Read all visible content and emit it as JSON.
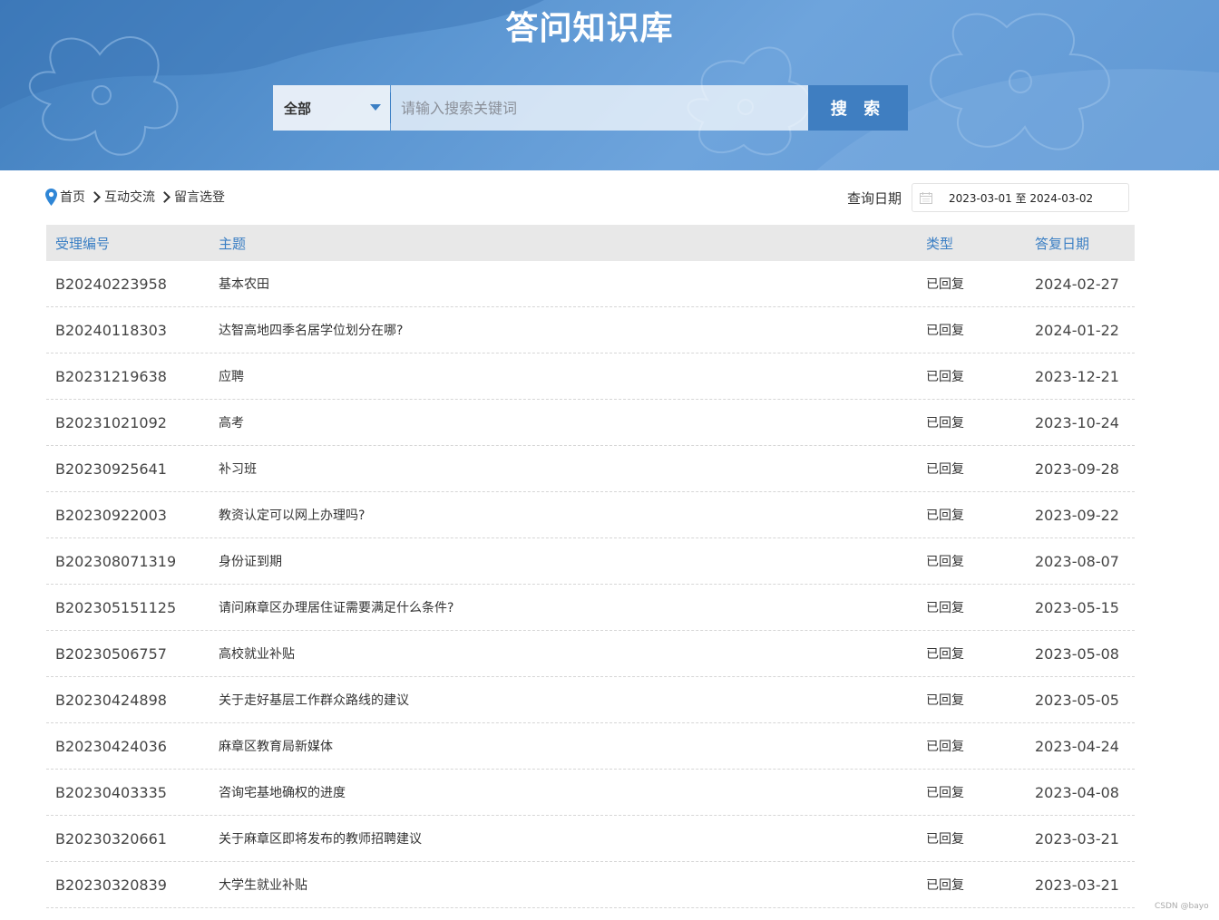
{
  "banner": {
    "title": "答问知识库"
  },
  "search": {
    "scope_value": "全部",
    "placeholder": "请输入搜索关键词",
    "button_label": "搜 索"
  },
  "breadcrumb": {
    "items": [
      "首页",
      "互动交流",
      "留言选登"
    ]
  },
  "date_query": {
    "label": "查询日期",
    "range": "2023-03-01 至 2024-03-02"
  },
  "table": {
    "headers": [
      "受理编号",
      "主题",
      "类型",
      "答复日期"
    ],
    "rows": [
      {
        "id": "B20240223958",
        "subject": "基本农田",
        "type": "已回复",
        "date": "2024-02-27"
      },
      {
        "id": "B20240118303",
        "subject": "达智高地四季名居学位划分在哪?",
        "type": "已回复",
        "date": "2024-01-22"
      },
      {
        "id": "B20231219638",
        "subject": "应聘",
        "type": "已回复",
        "date": "2023-12-21"
      },
      {
        "id": "B20231021092",
        "subject": "高考",
        "type": "已回复",
        "date": "2023-10-24"
      },
      {
        "id": "B20230925641",
        "subject": "补习班",
        "type": "已回复",
        "date": "2023-09-28"
      },
      {
        "id": "B20230922003",
        "subject": "教资认定可以网上办理吗?",
        "type": "已回复",
        "date": "2023-09-22"
      },
      {
        "id": "B202308071319",
        "subject": "身份证到期",
        "type": "已回复",
        "date": "2023-08-07"
      },
      {
        "id": "B202305151125",
        "subject": "请问麻章区办理居住证需要满足什么条件?",
        "type": "已回复",
        "date": "2023-05-15"
      },
      {
        "id": "B20230506757",
        "subject": "高校就业补贴",
        "type": "已回复",
        "date": "2023-05-08"
      },
      {
        "id": "B20230424898",
        "subject": "关于走好基层工作群众路线的建议",
        "type": "已回复",
        "date": "2023-05-05"
      },
      {
        "id": "B20230424036",
        "subject": "麻章区教育局新媒体",
        "type": "已回复",
        "date": "2023-04-24"
      },
      {
        "id": "B20230403335",
        "subject": "咨询宅基地确权的进度",
        "type": "已回复",
        "date": "2023-04-08"
      },
      {
        "id": "B20230320661",
        "subject": "关于麻章区即将发布的教师招聘建议",
        "type": "已回复",
        "date": "2023-03-21"
      },
      {
        "id": "B20230320839",
        "subject": "大学生就业补贴",
        "type": "已回复",
        "date": "2023-03-21"
      }
    ]
  },
  "watermark": "CSDN @bayo",
  "colors": {
    "accent": "#3b7fc4",
    "banner": "#5b96d2",
    "header_bg": "#e8e8e8"
  }
}
